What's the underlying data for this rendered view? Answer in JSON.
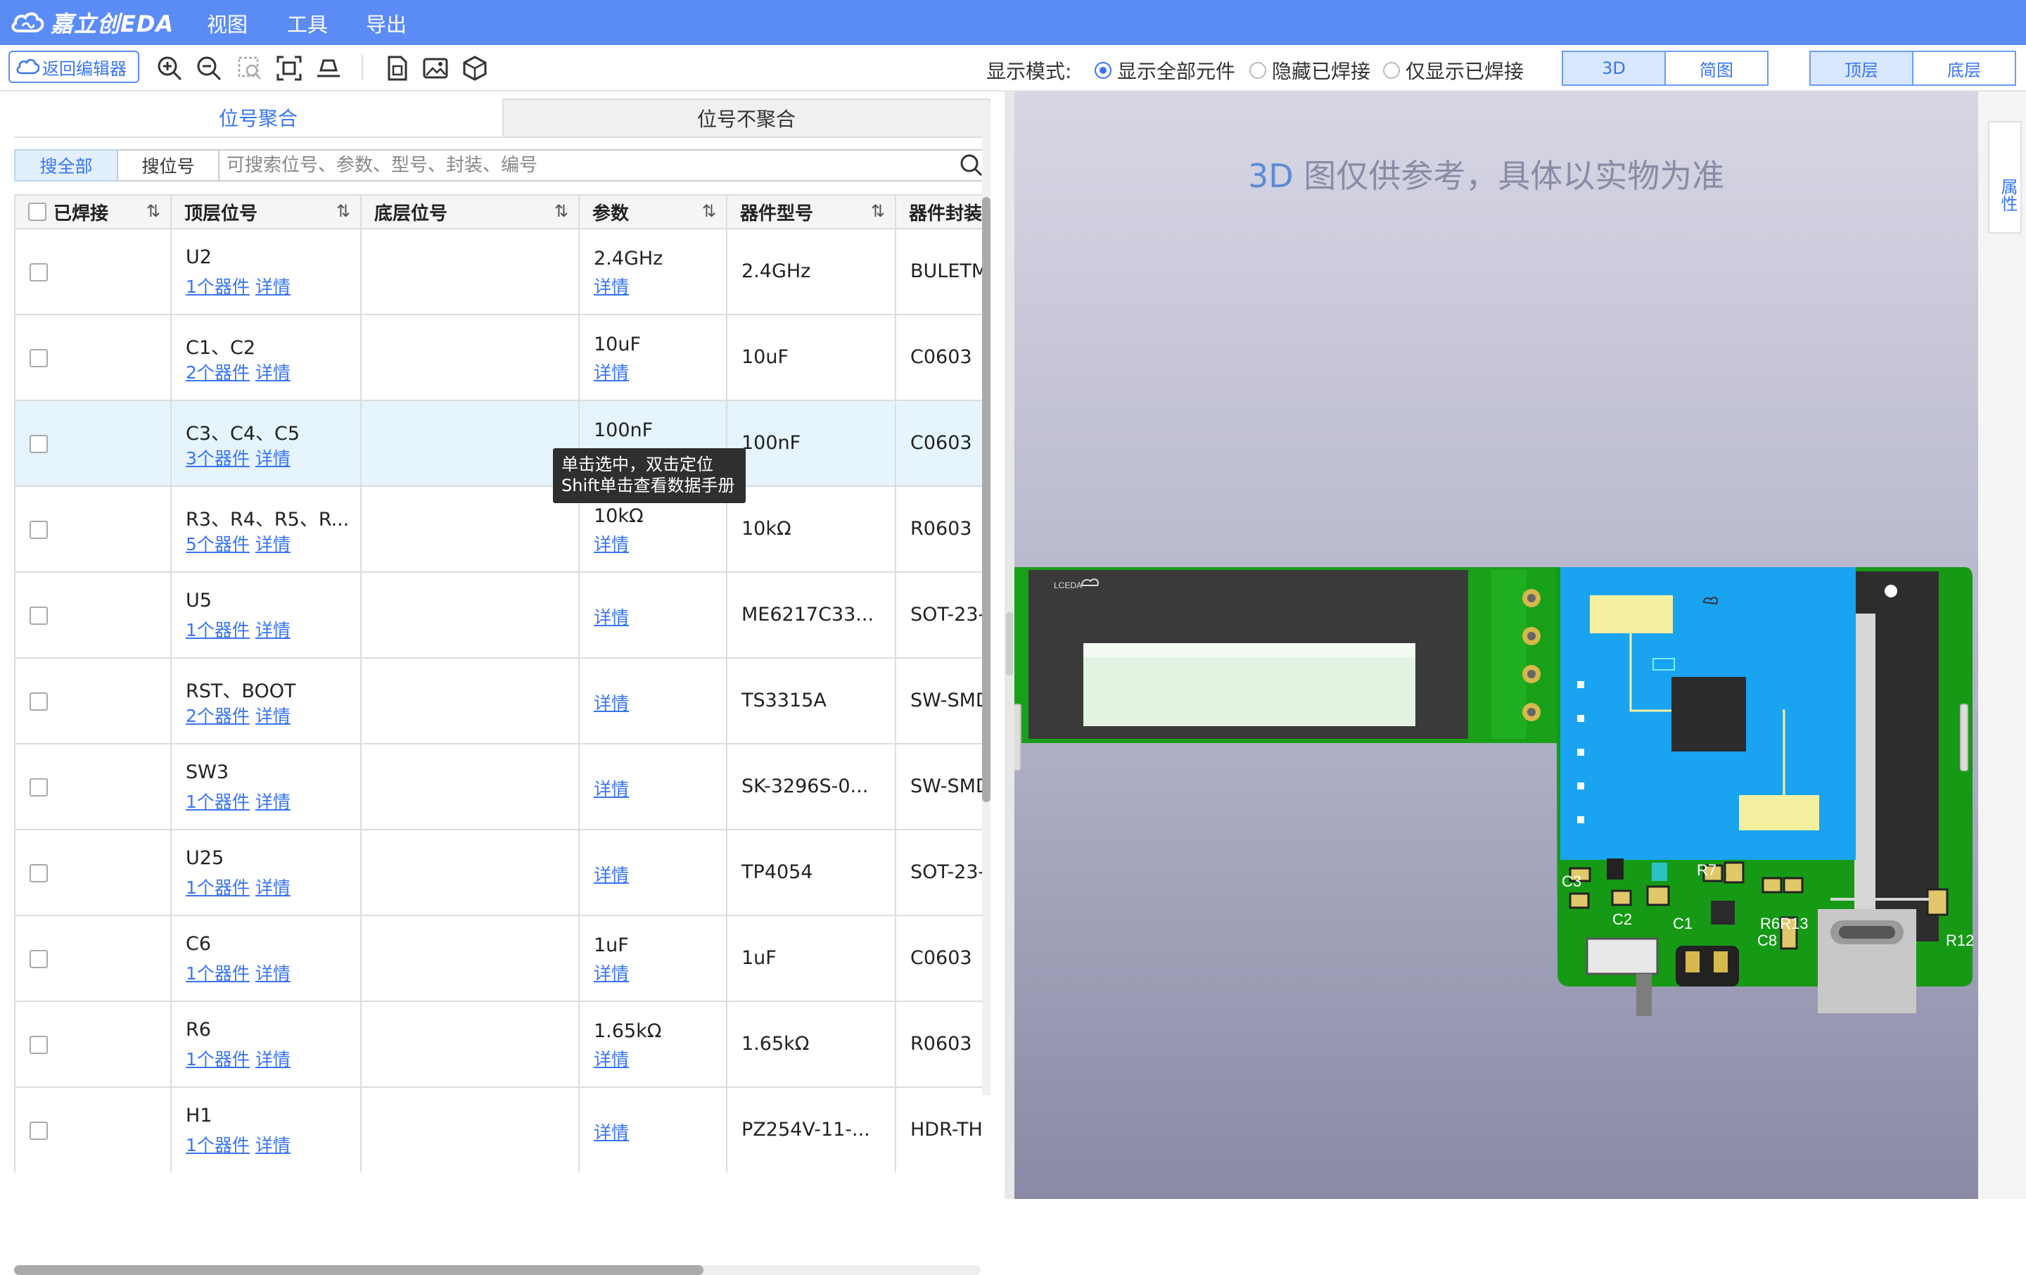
{
  "app": {
    "logo_text": "嘉立创EDA",
    "menu": [
      "视图",
      "工具",
      "导出"
    ]
  },
  "toolbar": {
    "back_label": "返回编辑器",
    "mode_label": "显示模式:",
    "radios": [
      "显示全部元件",
      "隐藏已焊接",
      "仅显示已焊接"
    ],
    "view_buttons": [
      "3D",
      "简图"
    ],
    "layer_buttons": [
      "顶层",
      "底层"
    ]
  },
  "left": {
    "tabs": [
      "位号聚合",
      "位号不聚合"
    ],
    "search_buttons": [
      "搜全部",
      "搜位号"
    ],
    "search_placeholder": "可搜索位号、参数、型号、封装、编号",
    "columns": [
      "已焊接",
      "顶层位号",
      "底层位号",
      "参数",
      "器件型号",
      "器件封装"
    ],
    "sort_glyph": "⇅",
    "detail_label": "详情",
    "rows": [
      {
        "ref": "U2",
        "count": "1个器件",
        "param": "2.4GHz",
        "model": "2.4GHz",
        "pkg": "BULETM"
      },
      {
        "ref": "C1、C2",
        "count": "2个器件",
        "param": "10uF",
        "model": "10uF",
        "pkg": "C0603"
      },
      {
        "ref": "C3、C4、C5",
        "count": "3个器件",
        "param": "100nF",
        "model": "100nF",
        "pkg": "C0603"
      },
      {
        "ref": "R3、R4、R5、R...",
        "count": "5个器件",
        "param": "10kΩ",
        "model": "10kΩ",
        "pkg": "R0603"
      },
      {
        "ref": "U5",
        "count": "1个器件",
        "param": "",
        "model": "ME6217C33...",
        "pkg": "SOT-23-"
      },
      {
        "ref": "RST、BOOT",
        "count": "2个器件",
        "param": "",
        "model": "TS3315A",
        "pkg": "SW-SMD"
      },
      {
        "ref": "SW3",
        "count": "1个器件",
        "param": "",
        "model": "SK-3296S-0...",
        "pkg": "SW-SMD"
      },
      {
        "ref": "U25",
        "count": "1个器件",
        "param": "",
        "model": "TP4054",
        "pkg": "SOT-23-"
      },
      {
        "ref": "C6",
        "count": "1个器件",
        "param": "1uF",
        "model": "1uF",
        "pkg": "C0603"
      },
      {
        "ref": "R6",
        "count": "1个器件",
        "param": "1.65kΩ",
        "model": "1.65kΩ",
        "pkg": "R0603"
      },
      {
        "ref": "H1",
        "count": "1个器件",
        "param": "",
        "model": "PZ254V-11-...",
        "pkg": "HDR-TH"
      }
    ],
    "tooltip": [
      "单击选中，双击定位",
      "Shift单击查看数据手册"
    ]
  },
  "viewer": {
    "note_accent": "3D",
    "note_rest": " 图仅供参考，具体以实物为准",
    "silk_labels": [
      "C3",
      "C2",
      "C1",
      "R7",
      "R6R13",
      "C8",
      "R12"
    ],
    "logo_small": "LCEDA"
  },
  "rightbar": {
    "property_tab": "属性"
  },
  "colors": {
    "titlebar": "#5b8cf6",
    "accent": "#3a75f0",
    "pcb_green": "#1aa21a",
    "module_blue": "#1aa3f0"
  }
}
